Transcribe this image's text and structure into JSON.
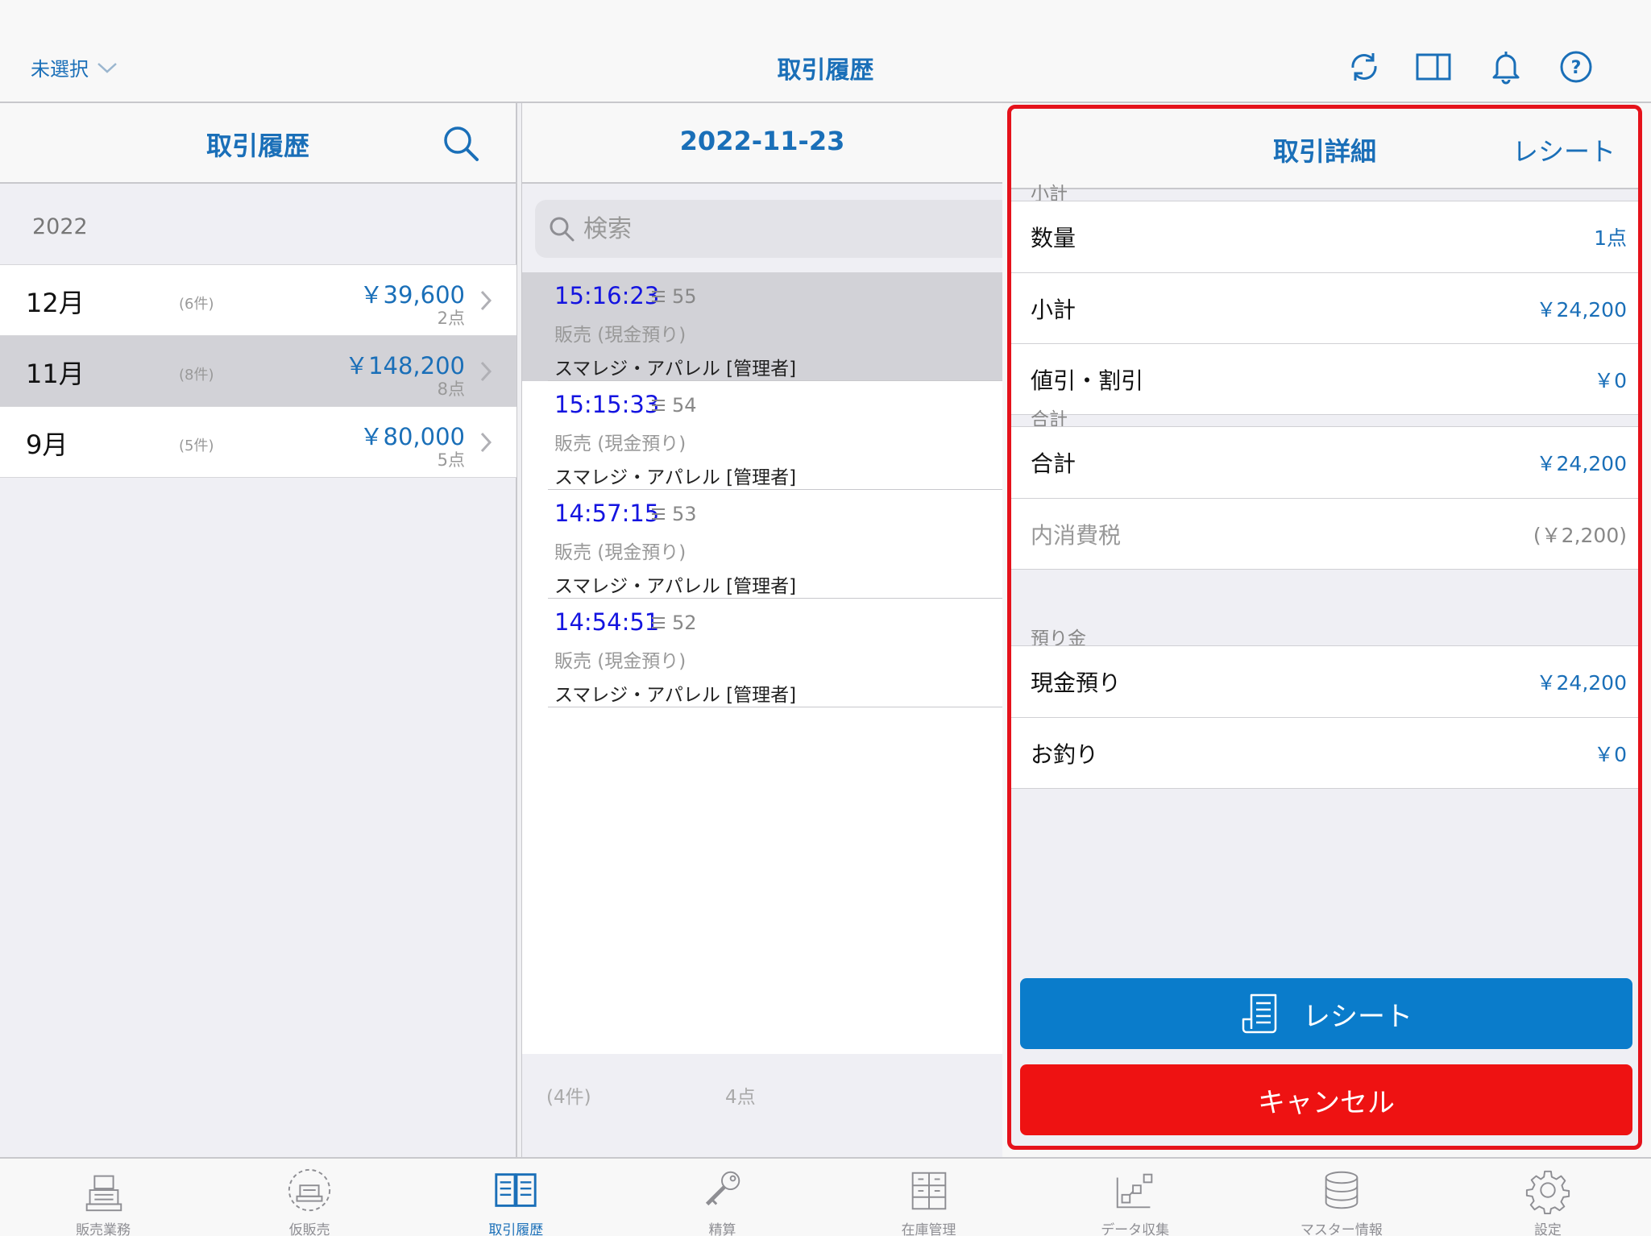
{
  "topbar": {
    "store_select": "未選択",
    "title": "取引履歴",
    "icons": [
      "refresh-icon",
      "split-view-icon",
      "bell-icon",
      "help-icon"
    ]
  },
  "left": {
    "title": "取引履歴",
    "year": "2022",
    "months": [
      {
        "name": "12月",
        "count": "(6件)",
        "amount": "￥39,600",
        "points": "2点",
        "selected": false
      },
      {
        "name": "11月",
        "count": "(8件)",
        "amount": "￥148,200",
        "points": "8点",
        "selected": true
      },
      {
        "name": "9月",
        "count": "(5件)",
        "amount": "￥80,000",
        "points": "5点",
        "selected": false
      }
    ]
  },
  "middle": {
    "date": "2022-11-23",
    "search_placeholder": "検索",
    "transactions": [
      {
        "time": "15:16:23",
        "no": "55",
        "type": "販売 (現金預り)",
        "staff": "スマレジ・アパレル [管理者]",
        "selected": true
      },
      {
        "time": "15:15:33",
        "no": "54",
        "type": "販売 (現金預り)",
        "staff": "スマレジ・アパレル [管理者]",
        "selected": false
      },
      {
        "time": "14:57:15",
        "no": "53",
        "type": "販売 (現金預り)",
        "staff": "スマレジ・アパレル [管理者]",
        "selected": false
      },
      {
        "time": "14:54:51",
        "no": "52",
        "type": "販売 (現金預り)",
        "staff": "スマレジ・アパレル [管理者]",
        "selected": false
      }
    ],
    "footer_count": "(4件)",
    "footer_points": "4点"
  },
  "right": {
    "title": "取引詳細",
    "receipt_link": "レシート",
    "sections": [
      {
        "label": "小計",
        "rows": [
          {
            "label": "数量",
            "value": "1点"
          },
          {
            "label": "小計",
            "value": "￥24,200"
          },
          {
            "label": "値引・割引",
            "value": "￥0"
          }
        ]
      },
      {
        "label": "合計",
        "rows": [
          {
            "label": "合計",
            "value": "￥24,200"
          },
          {
            "label": "内消費税",
            "value": "(￥2,200)",
            "muted": true
          }
        ]
      },
      {
        "label": "預り金",
        "rows": [
          {
            "label": "現金預り",
            "value": "￥24,200"
          },
          {
            "label": "お釣り",
            "value": "￥0"
          }
        ]
      }
    ],
    "receipt_button": "レシート",
    "cancel_button": "キャンセル",
    "colors": {
      "highlight_border": "#e5121b",
      "receipt_button": "#0a7ccb",
      "cancel_button": "#ee1212"
    }
  },
  "tabbar": {
    "tabs": [
      {
        "label": "販売業務",
        "icon": "register-icon",
        "active": false
      },
      {
        "label": "仮販売",
        "icon": "temp-register-icon",
        "active": false
      },
      {
        "label": "取引履歴",
        "icon": "book-icon",
        "active": true
      },
      {
        "label": "精算",
        "icon": "key-icon",
        "active": false
      },
      {
        "label": "在庫管理",
        "icon": "inventory-icon",
        "active": false
      },
      {
        "label": "データ収集",
        "icon": "data-collect-icon",
        "active": false
      },
      {
        "label": "マスター情報",
        "icon": "database-icon",
        "active": false
      },
      {
        "label": "設定",
        "icon": "gear-icon",
        "active": false
      }
    ]
  },
  "accent_color": "#1a6fb8"
}
